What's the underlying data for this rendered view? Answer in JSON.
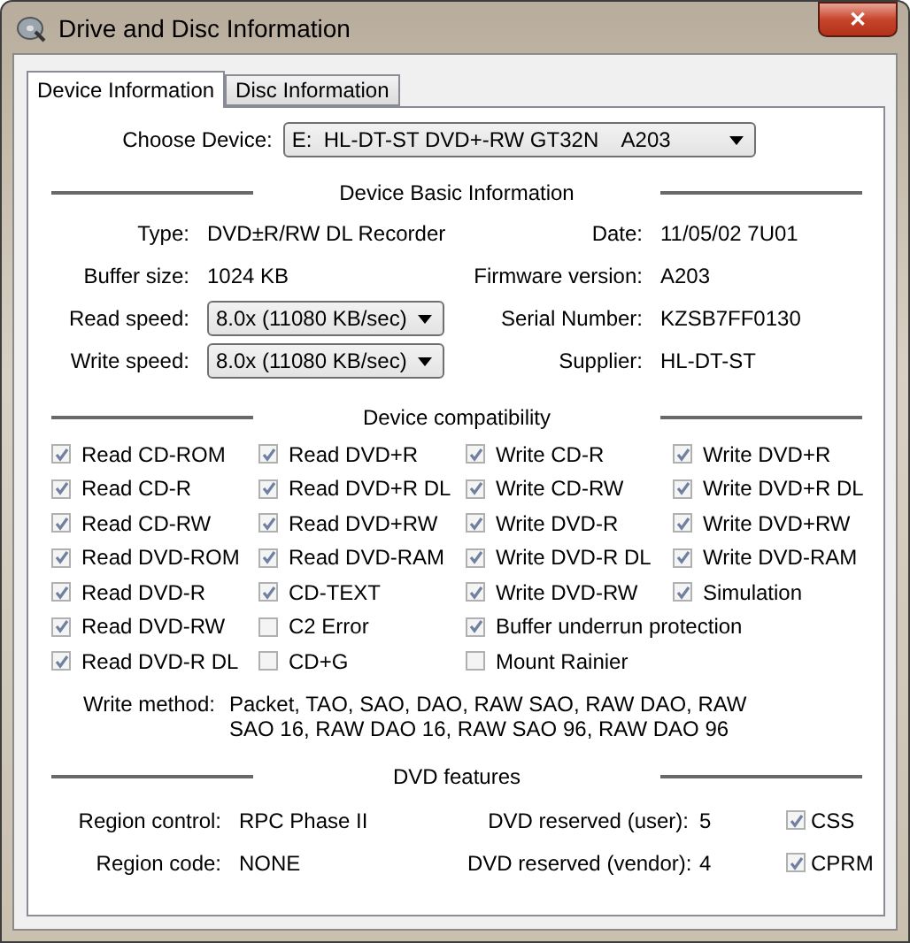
{
  "window": {
    "title": "Drive and Disc Information",
    "close": "✕"
  },
  "tabs": [
    {
      "label": "Device Information",
      "selected": true
    },
    {
      "label": "Disc Information",
      "selected": false
    }
  ],
  "device": {
    "label": "Choose Device:",
    "value": "E:  HL-DT-ST DVD+-RW GT32N    A203"
  },
  "basic": {
    "title": "Device Basic Information",
    "left": [
      {
        "kind": "text",
        "label": "Type:",
        "value": "DVD±R/RW DL Recorder"
      },
      {
        "kind": "text",
        "label": "Buffer size:",
        "value": "1024 KB"
      },
      {
        "kind": "dropdown",
        "label": "Read speed:",
        "value": "8.0x (11080 KB/sec)"
      },
      {
        "kind": "dropdown",
        "label": "Write speed:",
        "value": "8.0x (11080 KB/sec)"
      }
    ],
    "right": [
      {
        "label": "Date:",
        "value": "11/05/02 7U01"
      },
      {
        "label": "Firmware version:",
        "value": "A203"
      },
      {
        "label": "Serial Number:",
        "value": "KZSB7FF0130"
      },
      {
        "label": "Supplier:",
        "value": "HL-DT-ST"
      }
    ]
  },
  "compat": {
    "title": "Device compatibility",
    "columns": [
      [
        {
          "label": "Read CD-ROM",
          "checked": true
        },
        {
          "label": "Read CD-R",
          "checked": true
        },
        {
          "label": "Read CD-RW",
          "checked": true
        },
        {
          "label": "Read DVD-ROM",
          "checked": true
        },
        {
          "label": "Read DVD-R",
          "checked": true
        },
        {
          "label": "Read DVD-RW",
          "checked": true
        },
        {
          "label": "Read DVD-R DL",
          "checked": true
        }
      ],
      [
        {
          "label": "Read DVD+R",
          "checked": true
        },
        {
          "label": "Read DVD+R DL",
          "checked": true
        },
        {
          "label": "Read DVD+RW",
          "checked": true
        },
        {
          "label": "Read DVD-RAM",
          "checked": true
        },
        {
          "label": "CD-TEXT",
          "checked": true
        },
        {
          "label": "C2 Error",
          "checked": false
        },
        {
          "label": "CD+G",
          "checked": false
        }
      ],
      [
        {
          "label": "Write CD-R",
          "checked": true
        },
        {
          "label": "Write CD-RW",
          "checked": true
        },
        {
          "label": "Write DVD-R",
          "checked": true
        },
        {
          "label": "Write DVD-R DL",
          "checked": true
        },
        {
          "label": "Write DVD-RW",
          "checked": true
        },
        {
          "label": "Buffer underrun protection",
          "checked": true
        },
        {
          "label": "Mount Rainier",
          "checked": false
        }
      ],
      [
        {
          "label": "Write DVD+R",
          "checked": true
        },
        {
          "label": "Write DVD+R DL",
          "checked": true
        },
        {
          "label": "Write DVD+RW",
          "checked": true
        },
        {
          "label": "Write DVD-RAM",
          "checked": true
        },
        {
          "label": "Simulation",
          "checked": true
        }
      ]
    ],
    "write_method": {
      "label": "Write method:",
      "value": "Packet, TAO, SAO, DAO, RAW SAO, RAW DAO, RAW SAO 16, RAW DAO 16, RAW SAO 96, RAW DAO 96"
    }
  },
  "dvd": {
    "title": "DVD features",
    "left": [
      {
        "label": "Region control:",
        "value": "RPC Phase II"
      },
      {
        "label": "Region code:",
        "value": "NONE"
      }
    ],
    "middle": [
      {
        "label": "DVD reserved (user):",
        "value": "5"
      },
      {
        "label": "DVD reserved (vendor):",
        "value": "4"
      }
    ],
    "checks": [
      {
        "label": "CSS",
        "checked": true
      },
      {
        "label": "CPRM",
        "checked": true
      }
    ]
  }
}
